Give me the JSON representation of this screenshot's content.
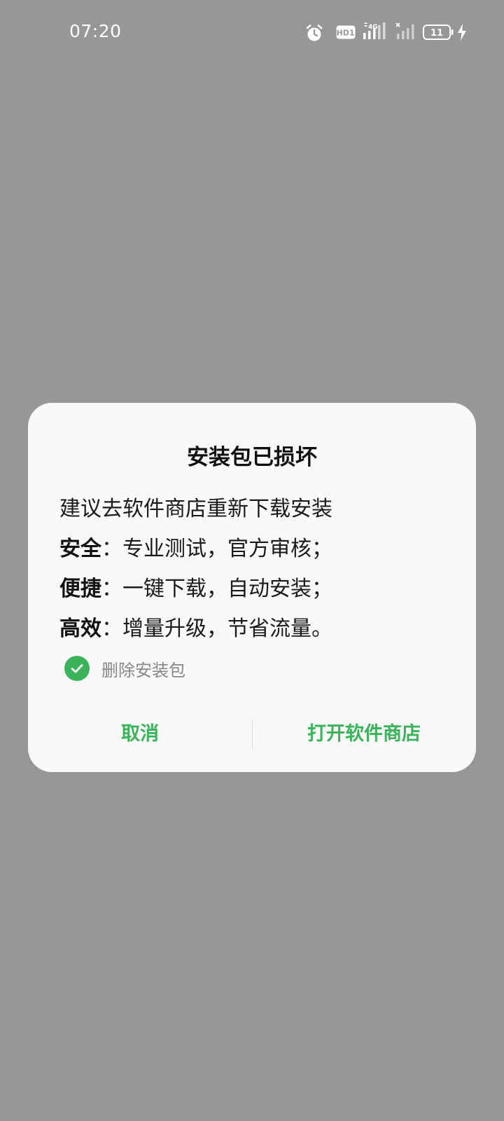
{
  "status_bar": {
    "time": "07:20",
    "icons": [
      "alarm-icon",
      "hd-icon",
      "4g-signal-icon",
      "no-sim-signal-icon",
      "battery-icon",
      "charging-icon"
    ],
    "hd_label": "HD1",
    "network_label": "4G",
    "battery_level": "11"
  },
  "dialog": {
    "title": "安装包已损坏",
    "intro": "建议去软件商店重新下载安装",
    "features": [
      {
        "label": "安全",
        "text": "：专业测试，官方审核；"
      },
      {
        "label": "便捷",
        "text": "：一键下载，自动安装；"
      },
      {
        "label": "高效",
        "text": "：增量升级，节省流量。"
      }
    ],
    "checkbox": {
      "label": "删除安装包",
      "checked": true
    },
    "cancel_label": "取消",
    "open_store_label": "打开软件商店"
  },
  "colors": {
    "scrim": "#979797",
    "dialog_bg": "#f9f9f9",
    "accent": "#3ab35a",
    "muted_text": "#888888"
  }
}
